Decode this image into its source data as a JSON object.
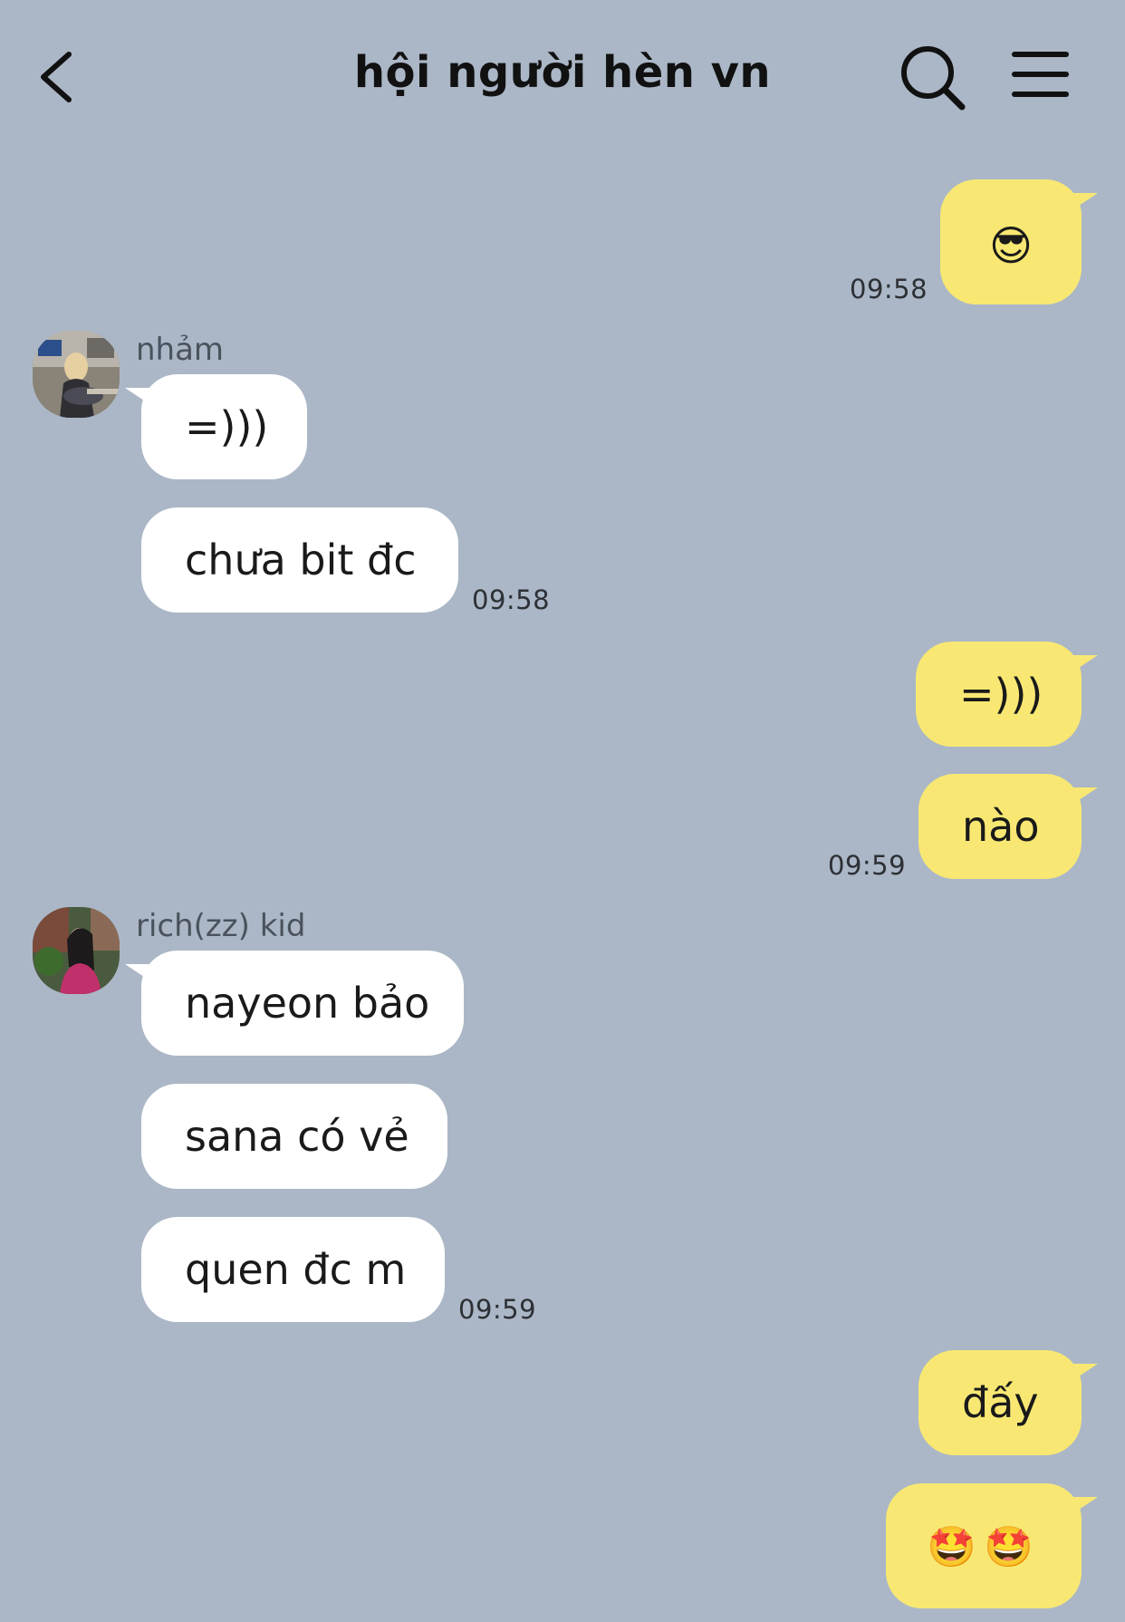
{
  "header": {
    "title": "hội người hèn vn"
  },
  "messages": [
    {
      "sender": "me",
      "content": "😎",
      "time": "09:58"
    },
    {
      "sender_name": "nhảm",
      "content": "=)))"
    },
    {
      "sender_name": "nhảm",
      "content": "chưa bit đc",
      "time": "09:58"
    },
    {
      "sender": "me",
      "content": "=)))"
    },
    {
      "sender": "me",
      "content": "nào",
      "time": "09:59"
    },
    {
      "sender_name": "rich(zz) kid",
      "content": "nayeon bảo"
    },
    {
      "sender_name": "rich(zz) kid",
      "content": "sana có vẻ"
    },
    {
      "sender_name": "rich(zz) kid",
      "content": "quen đc m",
      "time": "09:59"
    },
    {
      "sender": "me",
      "content": "đấy"
    },
    {
      "sender": "me",
      "content": "🤩🤩"
    }
  ],
  "colors": {
    "background": "#abb7c6",
    "outgoing_bubble": "#f8e873",
    "incoming_bubble": "#ffffff"
  }
}
